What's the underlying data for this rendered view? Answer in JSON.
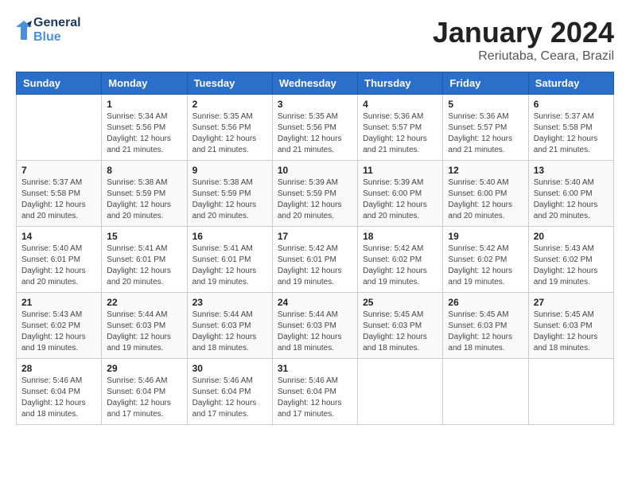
{
  "header": {
    "logo_general": "General",
    "logo_blue": "Blue",
    "month_year": "January 2024",
    "location": "Reriutaba, Ceara, Brazil"
  },
  "weekdays": [
    "Sunday",
    "Monday",
    "Tuesday",
    "Wednesday",
    "Thursday",
    "Friday",
    "Saturday"
  ],
  "weeks": [
    [
      {
        "day": "",
        "info": ""
      },
      {
        "day": "1",
        "info": "Sunrise: 5:34 AM\nSunset: 5:56 PM\nDaylight: 12 hours\nand 21 minutes."
      },
      {
        "day": "2",
        "info": "Sunrise: 5:35 AM\nSunset: 5:56 PM\nDaylight: 12 hours\nand 21 minutes."
      },
      {
        "day": "3",
        "info": "Sunrise: 5:35 AM\nSunset: 5:56 PM\nDaylight: 12 hours\nand 21 minutes."
      },
      {
        "day": "4",
        "info": "Sunrise: 5:36 AM\nSunset: 5:57 PM\nDaylight: 12 hours\nand 21 minutes."
      },
      {
        "day": "5",
        "info": "Sunrise: 5:36 AM\nSunset: 5:57 PM\nDaylight: 12 hours\nand 21 minutes."
      },
      {
        "day": "6",
        "info": "Sunrise: 5:37 AM\nSunset: 5:58 PM\nDaylight: 12 hours\nand 21 minutes."
      }
    ],
    [
      {
        "day": "7",
        "info": "Sunrise: 5:37 AM\nSunset: 5:58 PM\nDaylight: 12 hours\nand 20 minutes."
      },
      {
        "day": "8",
        "info": "Sunrise: 5:38 AM\nSunset: 5:59 PM\nDaylight: 12 hours\nand 20 minutes."
      },
      {
        "day": "9",
        "info": "Sunrise: 5:38 AM\nSunset: 5:59 PM\nDaylight: 12 hours\nand 20 minutes."
      },
      {
        "day": "10",
        "info": "Sunrise: 5:39 AM\nSunset: 5:59 PM\nDaylight: 12 hours\nand 20 minutes."
      },
      {
        "day": "11",
        "info": "Sunrise: 5:39 AM\nSunset: 6:00 PM\nDaylight: 12 hours\nand 20 minutes."
      },
      {
        "day": "12",
        "info": "Sunrise: 5:40 AM\nSunset: 6:00 PM\nDaylight: 12 hours\nand 20 minutes."
      },
      {
        "day": "13",
        "info": "Sunrise: 5:40 AM\nSunset: 6:00 PM\nDaylight: 12 hours\nand 20 minutes."
      }
    ],
    [
      {
        "day": "14",
        "info": "Sunrise: 5:40 AM\nSunset: 6:01 PM\nDaylight: 12 hours\nand 20 minutes."
      },
      {
        "day": "15",
        "info": "Sunrise: 5:41 AM\nSunset: 6:01 PM\nDaylight: 12 hours\nand 20 minutes."
      },
      {
        "day": "16",
        "info": "Sunrise: 5:41 AM\nSunset: 6:01 PM\nDaylight: 12 hours\nand 19 minutes."
      },
      {
        "day": "17",
        "info": "Sunrise: 5:42 AM\nSunset: 6:01 PM\nDaylight: 12 hours\nand 19 minutes."
      },
      {
        "day": "18",
        "info": "Sunrise: 5:42 AM\nSunset: 6:02 PM\nDaylight: 12 hours\nand 19 minutes."
      },
      {
        "day": "19",
        "info": "Sunrise: 5:42 AM\nSunset: 6:02 PM\nDaylight: 12 hours\nand 19 minutes."
      },
      {
        "day": "20",
        "info": "Sunrise: 5:43 AM\nSunset: 6:02 PM\nDaylight: 12 hours\nand 19 minutes."
      }
    ],
    [
      {
        "day": "21",
        "info": "Sunrise: 5:43 AM\nSunset: 6:02 PM\nDaylight: 12 hours\nand 19 minutes."
      },
      {
        "day": "22",
        "info": "Sunrise: 5:44 AM\nSunset: 6:03 PM\nDaylight: 12 hours\nand 19 minutes."
      },
      {
        "day": "23",
        "info": "Sunrise: 5:44 AM\nSunset: 6:03 PM\nDaylight: 12 hours\nand 18 minutes."
      },
      {
        "day": "24",
        "info": "Sunrise: 5:44 AM\nSunset: 6:03 PM\nDaylight: 12 hours\nand 18 minutes."
      },
      {
        "day": "25",
        "info": "Sunrise: 5:45 AM\nSunset: 6:03 PM\nDaylight: 12 hours\nand 18 minutes."
      },
      {
        "day": "26",
        "info": "Sunrise: 5:45 AM\nSunset: 6:03 PM\nDaylight: 12 hours\nand 18 minutes."
      },
      {
        "day": "27",
        "info": "Sunrise: 5:45 AM\nSunset: 6:03 PM\nDaylight: 12 hours\nand 18 minutes."
      }
    ],
    [
      {
        "day": "28",
        "info": "Sunrise: 5:46 AM\nSunset: 6:04 PM\nDaylight: 12 hours\nand 18 minutes."
      },
      {
        "day": "29",
        "info": "Sunrise: 5:46 AM\nSunset: 6:04 PM\nDaylight: 12 hours\nand 17 minutes."
      },
      {
        "day": "30",
        "info": "Sunrise: 5:46 AM\nSunset: 6:04 PM\nDaylight: 12 hours\nand 17 minutes."
      },
      {
        "day": "31",
        "info": "Sunrise: 5:46 AM\nSunset: 6:04 PM\nDaylight: 12 hours\nand 17 minutes."
      },
      {
        "day": "",
        "info": ""
      },
      {
        "day": "",
        "info": ""
      },
      {
        "day": "",
        "info": ""
      }
    ]
  ]
}
